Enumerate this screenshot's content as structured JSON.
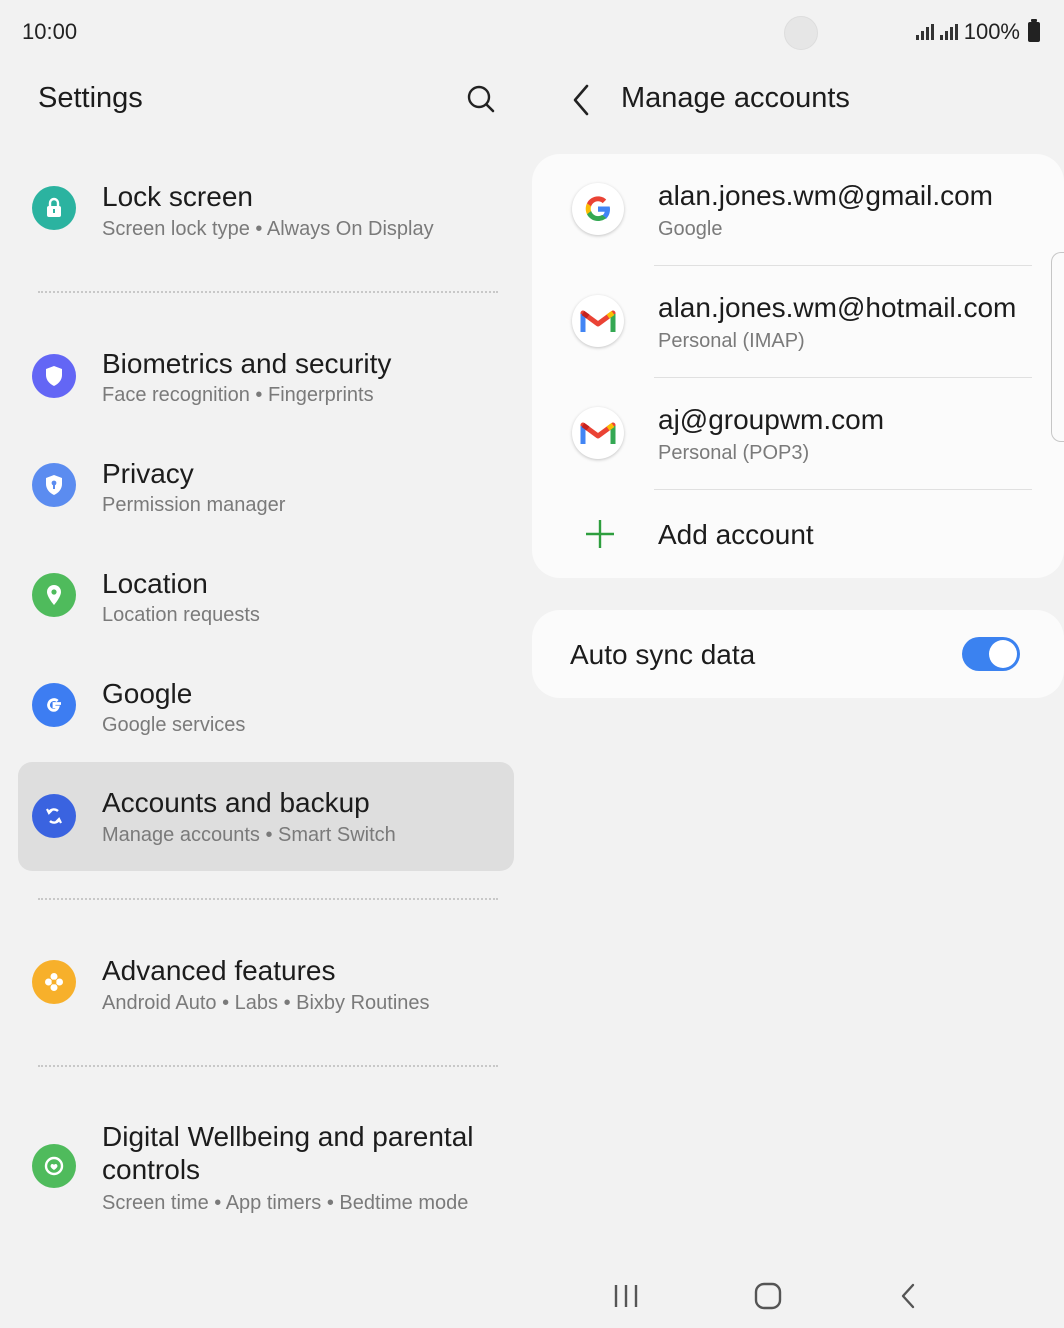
{
  "status": {
    "time": "10:00",
    "battery": "100%"
  },
  "settings": {
    "title": "Settings",
    "items": [
      {
        "title": "Lock screen",
        "subtitle": "Screen lock type  •  Always On Display",
        "icon": "lock-icon",
        "color": "#2bb3a0"
      },
      {
        "title": "Biometrics and security",
        "subtitle": "Face recognition  •  Fingerprints",
        "icon": "shield-icon",
        "color": "#6366f5"
      },
      {
        "title": "Privacy",
        "subtitle": "Permission manager",
        "icon": "privacy-shield-icon",
        "color": "#5b8cf0"
      },
      {
        "title": "Location",
        "subtitle": "Location requests",
        "icon": "location-pin-icon",
        "color": "#4fbb5c"
      },
      {
        "title": "Google",
        "subtitle": "Google services",
        "icon": "google-g-icon",
        "color": "#3d7df2"
      },
      {
        "title": "Accounts and backup",
        "subtitle": "Manage accounts  •  Smart Switch",
        "icon": "sync-icon",
        "color": "#3a63e0"
      },
      {
        "title": "Advanced features",
        "subtitle": "Android Auto  •  Labs  •  Bixby Routines",
        "icon": "gear-flower-icon",
        "color": "#f7b02b"
      },
      {
        "title_line1": "Digital Wellbeing and parental",
        "title_line2": "controls",
        "subtitle": "Screen time  •  App timers  •  Bedtime mode",
        "icon": "wellbeing-icon",
        "color": "#4fbb5c"
      }
    ]
  },
  "manage_accounts": {
    "title": "Manage accounts",
    "accounts": [
      {
        "email": "alan.jones.wm@gmail.com",
        "type": "Google",
        "icon": "google-logo-icon"
      },
      {
        "email": "alan.jones.wm@hotmail.com",
        "type": "Personal (IMAP)",
        "icon": "gmail-logo-icon"
      },
      {
        "email": "aj@groupwm.com",
        "type": "Personal (POP3)",
        "icon": "gmail-logo-icon"
      }
    ],
    "add_account": "Add account",
    "auto_sync": {
      "label": "Auto sync data",
      "enabled": true
    }
  },
  "colors": {
    "accent": "#3b82f0",
    "selected_row": "#dedede",
    "background": "#f2f2f2"
  }
}
